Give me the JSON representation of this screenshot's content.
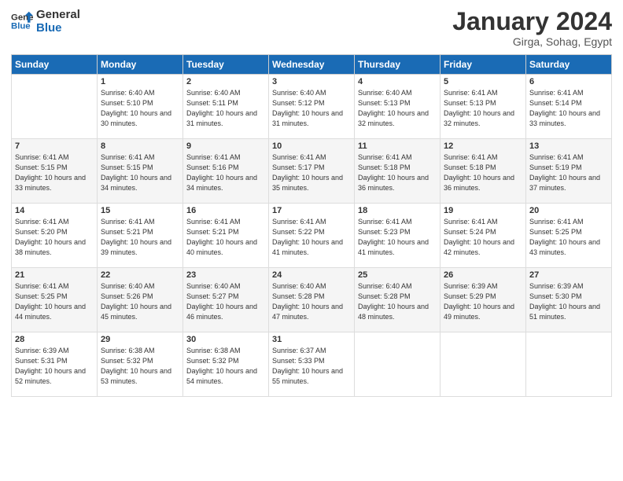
{
  "logo": {
    "line1": "General",
    "line2": "Blue"
  },
  "header": {
    "month_year": "January 2024",
    "location": "Girga, Sohag, Egypt"
  },
  "days_of_week": [
    "Sunday",
    "Monday",
    "Tuesday",
    "Wednesday",
    "Thursday",
    "Friday",
    "Saturday"
  ],
  "weeks": [
    [
      {
        "day": "",
        "sunrise": "",
        "sunset": "",
        "daylight": ""
      },
      {
        "day": "1",
        "sunrise": "6:40 AM",
        "sunset": "5:10 PM",
        "daylight": "10 hours and 30 minutes."
      },
      {
        "day": "2",
        "sunrise": "6:40 AM",
        "sunset": "5:11 PM",
        "daylight": "10 hours and 31 minutes."
      },
      {
        "day": "3",
        "sunrise": "6:40 AM",
        "sunset": "5:12 PM",
        "daylight": "10 hours and 31 minutes."
      },
      {
        "day": "4",
        "sunrise": "6:40 AM",
        "sunset": "5:13 PM",
        "daylight": "10 hours and 32 minutes."
      },
      {
        "day": "5",
        "sunrise": "6:41 AM",
        "sunset": "5:13 PM",
        "daylight": "10 hours and 32 minutes."
      },
      {
        "day": "6",
        "sunrise": "6:41 AM",
        "sunset": "5:14 PM",
        "daylight": "10 hours and 33 minutes."
      }
    ],
    [
      {
        "day": "7",
        "sunrise": "6:41 AM",
        "sunset": "5:15 PM",
        "daylight": "10 hours and 33 minutes."
      },
      {
        "day": "8",
        "sunrise": "6:41 AM",
        "sunset": "5:15 PM",
        "daylight": "10 hours and 34 minutes."
      },
      {
        "day": "9",
        "sunrise": "6:41 AM",
        "sunset": "5:16 PM",
        "daylight": "10 hours and 34 minutes."
      },
      {
        "day": "10",
        "sunrise": "6:41 AM",
        "sunset": "5:17 PM",
        "daylight": "10 hours and 35 minutes."
      },
      {
        "day": "11",
        "sunrise": "6:41 AM",
        "sunset": "5:18 PM",
        "daylight": "10 hours and 36 minutes."
      },
      {
        "day": "12",
        "sunrise": "6:41 AM",
        "sunset": "5:18 PM",
        "daylight": "10 hours and 36 minutes."
      },
      {
        "day": "13",
        "sunrise": "6:41 AM",
        "sunset": "5:19 PM",
        "daylight": "10 hours and 37 minutes."
      }
    ],
    [
      {
        "day": "14",
        "sunrise": "6:41 AM",
        "sunset": "5:20 PM",
        "daylight": "10 hours and 38 minutes."
      },
      {
        "day": "15",
        "sunrise": "6:41 AM",
        "sunset": "5:21 PM",
        "daylight": "10 hours and 39 minutes."
      },
      {
        "day": "16",
        "sunrise": "6:41 AM",
        "sunset": "5:21 PM",
        "daylight": "10 hours and 40 minutes."
      },
      {
        "day": "17",
        "sunrise": "6:41 AM",
        "sunset": "5:22 PM",
        "daylight": "10 hours and 41 minutes."
      },
      {
        "day": "18",
        "sunrise": "6:41 AM",
        "sunset": "5:23 PM",
        "daylight": "10 hours and 41 minutes."
      },
      {
        "day": "19",
        "sunrise": "6:41 AM",
        "sunset": "5:24 PM",
        "daylight": "10 hours and 42 minutes."
      },
      {
        "day": "20",
        "sunrise": "6:41 AM",
        "sunset": "5:25 PM",
        "daylight": "10 hours and 43 minutes."
      }
    ],
    [
      {
        "day": "21",
        "sunrise": "6:41 AM",
        "sunset": "5:25 PM",
        "daylight": "10 hours and 44 minutes."
      },
      {
        "day": "22",
        "sunrise": "6:40 AM",
        "sunset": "5:26 PM",
        "daylight": "10 hours and 45 minutes."
      },
      {
        "day": "23",
        "sunrise": "6:40 AM",
        "sunset": "5:27 PM",
        "daylight": "10 hours and 46 minutes."
      },
      {
        "day": "24",
        "sunrise": "6:40 AM",
        "sunset": "5:28 PM",
        "daylight": "10 hours and 47 minutes."
      },
      {
        "day": "25",
        "sunrise": "6:40 AM",
        "sunset": "5:28 PM",
        "daylight": "10 hours and 48 minutes."
      },
      {
        "day": "26",
        "sunrise": "6:39 AM",
        "sunset": "5:29 PM",
        "daylight": "10 hours and 49 minutes."
      },
      {
        "day": "27",
        "sunrise": "6:39 AM",
        "sunset": "5:30 PM",
        "daylight": "10 hours and 51 minutes."
      }
    ],
    [
      {
        "day": "28",
        "sunrise": "6:39 AM",
        "sunset": "5:31 PM",
        "daylight": "10 hours and 52 minutes."
      },
      {
        "day": "29",
        "sunrise": "6:38 AM",
        "sunset": "5:32 PM",
        "daylight": "10 hours and 53 minutes."
      },
      {
        "day": "30",
        "sunrise": "6:38 AM",
        "sunset": "5:32 PM",
        "daylight": "10 hours and 54 minutes."
      },
      {
        "day": "31",
        "sunrise": "6:37 AM",
        "sunset": "5:33 PM",
        "daylight": "10 hours and 55 minutes."
      },
      {
        "day": "",
        "sunrise": "",
        "sunset": "",
        "daylight": ""
      },
      {
        "day": "",
        "sunrise": "",
        "sunset": "",
        "daylight": ""
      },
      {
        "day": "",
        "sunrise": "",
        "sunset": "",
        "daylight": ""
      }
    ]
  ],
  "labels": {
    "sunrise_prefix": "Sunrise: ",
    "sunset_prefix": "Sunset: ",
    "daylight_prefix": "Daylight: "
  }
}
